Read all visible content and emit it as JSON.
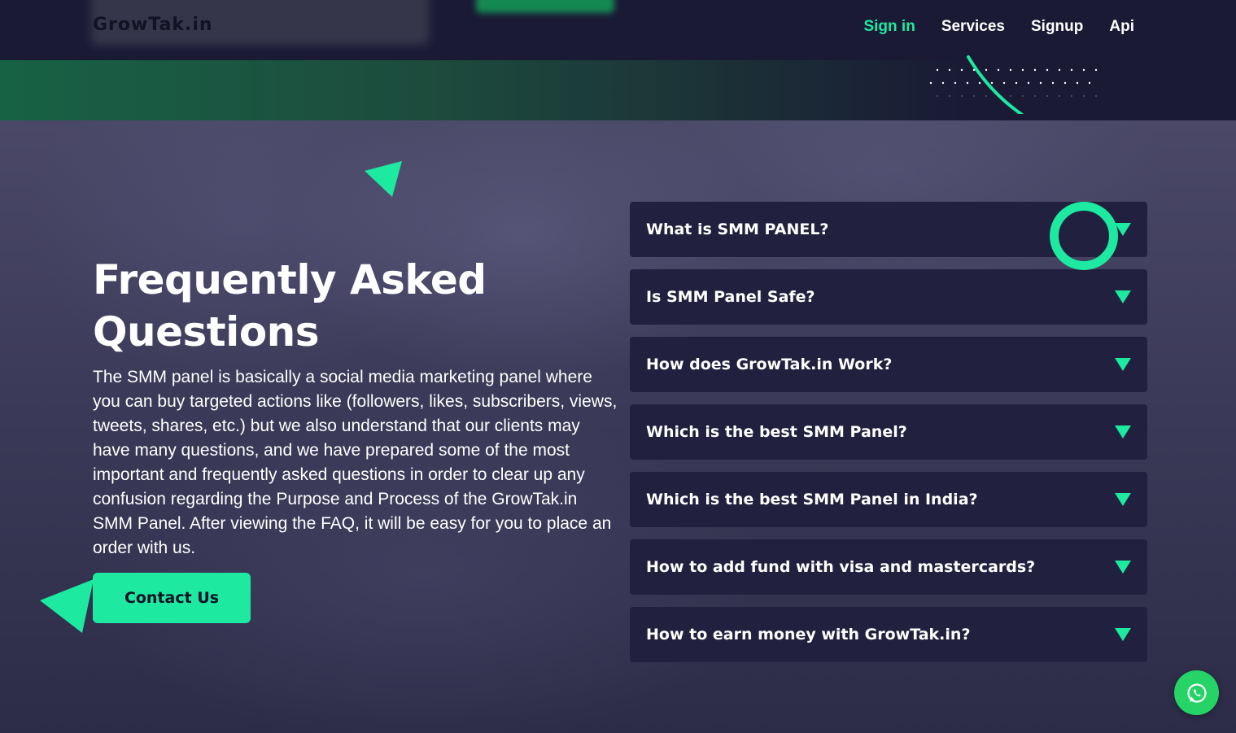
{
  "brand": {
    "name": "GrowTak.in"
  },
  "nav": {
    "items": [
      {
        "label": "Sign in",
        "active": true
      },
      {
        "label": "Services",
        "active": false
      },
      {
        "label": "Signup",
        "active": false
      },
      {
        "label": "Api",
        "active": false
      }
    ]
  },
  "hero": {
    "title": "Frequently Asked Questions",
    "description": "The SMM panel is basically a social media marketing panel where you can buy targeted actions like (followers, likes, subscribers, views, tweets, shares, etc.) but we also understand that our clients may have many questions, and we have prepared some of the most important and frequently asked questions in order to clear up any confusion regarding the Purpose and Process of the GrowTak.in SMM Panel. After viewing the FAQ, it will be easy for you to place an order with us.",
    "cta_label": "Contact Us"
  },
  "faq": {
    "items": [
      {
        "question": "What is SMM PANEL?"
      },
      {
        "question": "Is SMM Panel Safe?"
      },
      {
        "question": "How does GrowTak.in Work?"
      },
      {
        "question": "Which is the best SMM Panel?"
      },
      {
        "question": "Which is the best SMM Panel in India?"
      },
      {
        "question": "How to add fund with visa and mastercards?"
      },
      {
        "question": "How to earn money with GrowTak.in?"
      }
    ]
  },
  "colors": {
    "accent": "#1de9a0",
    "background": "#1c1b33",
    "card": "#21203e",
    "whatsapp": "#25d366"
  },
  "icons": {
    "caret": "caret-down-icon",
    "chat": "whatsapp-icon"
  }
}
